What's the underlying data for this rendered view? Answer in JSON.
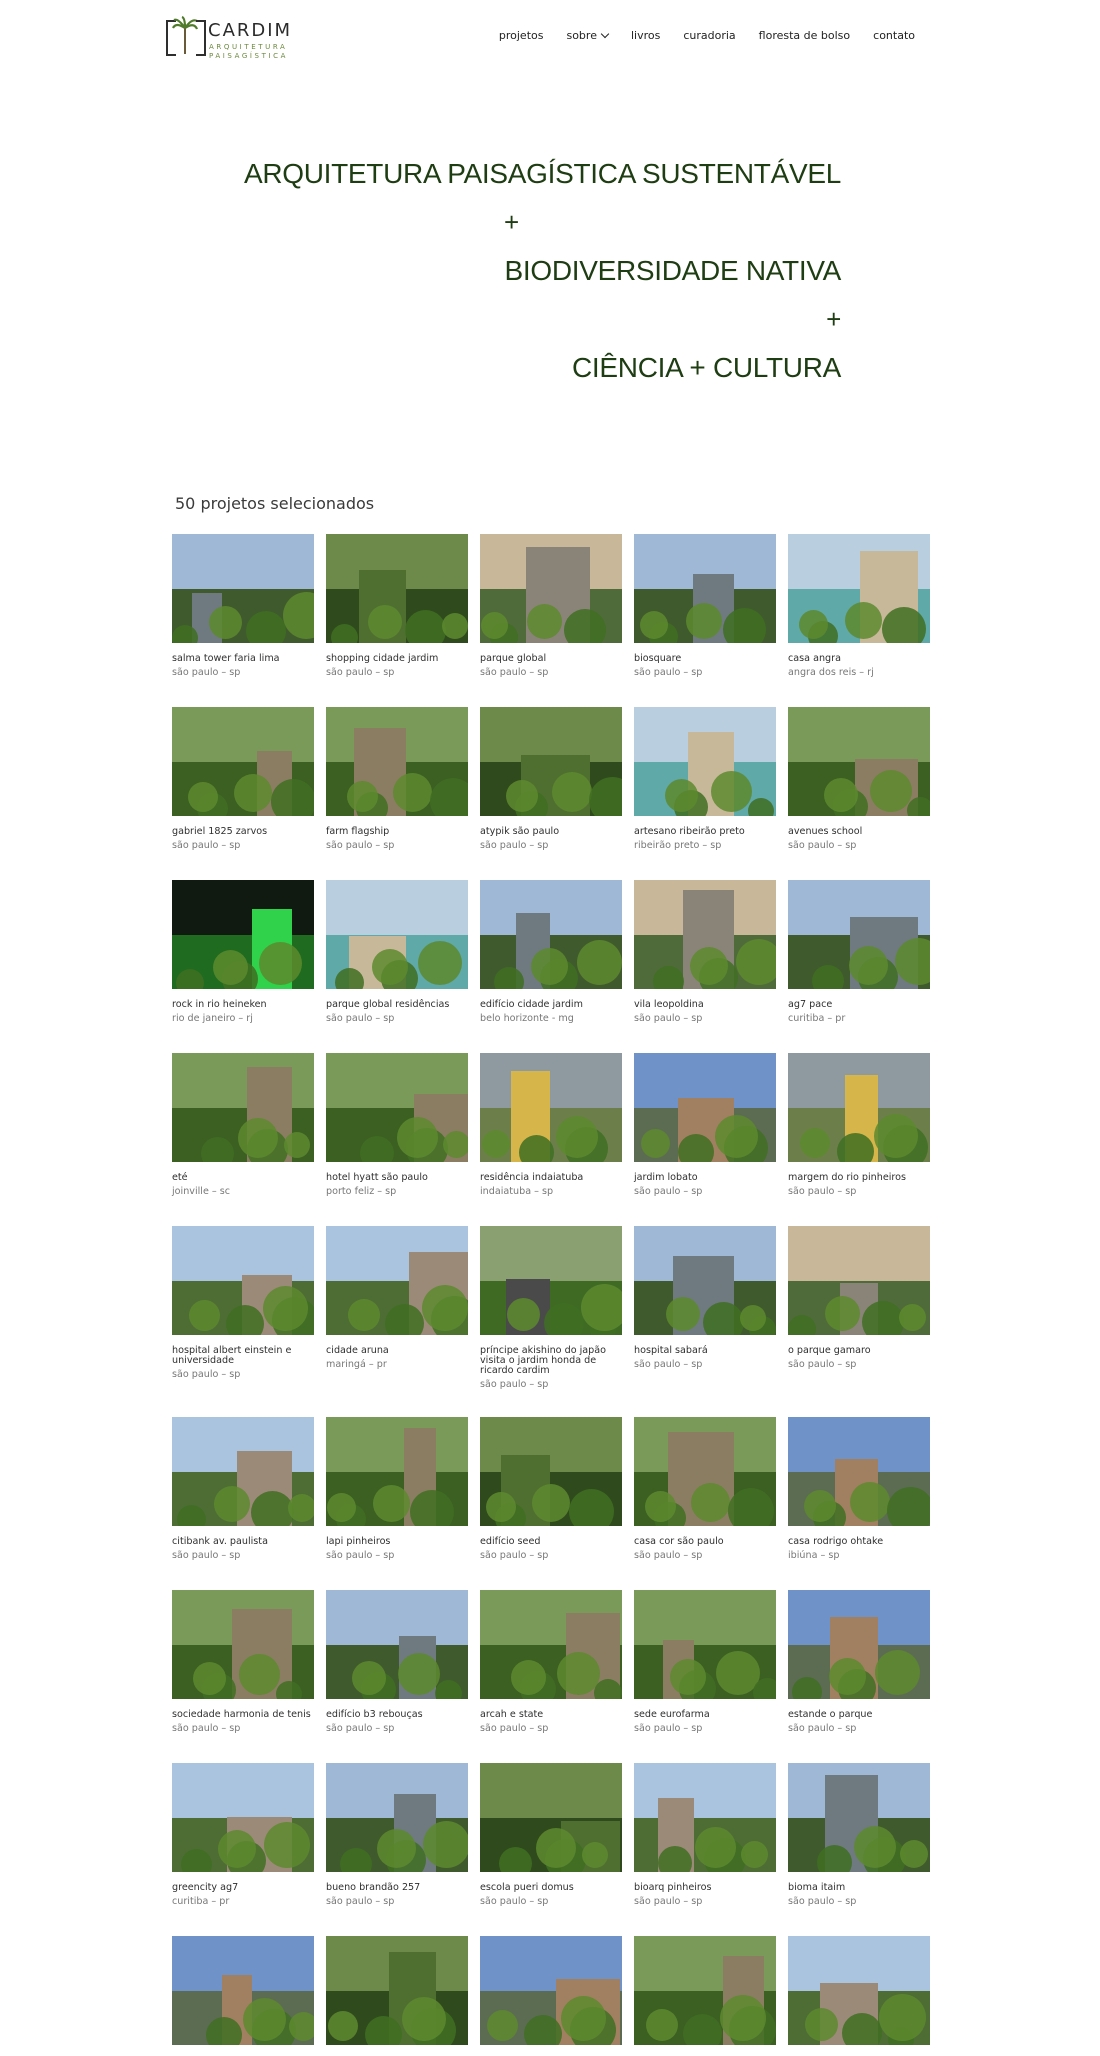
{
  "brand": {
    "name": "CARDIM",
    "tagline_1": "ARQUITETURA",
    "tagline_2": "PAISAGÍSTICA"
  },
  "nav": {
    "items": [
      {
        "label": "projetos",
        "has_dropdown": false
      },
      {
        "label": "sobre",
        "has_dropdown": true
      },
      {
        "label": "livros",
        "has_dropdown": false
      },
      {
        "label": "curadoria",
        "has_dropdown": false
      },
      {
        "label": "floresta de bolso",
        "has_dropdown": false
      },
      {
        "label": "contato",
        "has_dropdown": false
      }
    ]
  },
  "hero": {
    "line_1": "ARQUITETURA PAISAGÍSTICA SUSTENTÁVEL",
    "plus_1": "+",
    "line_2": "BIODIVERSIDADE NATIVA",
    "plus_2": "+",
    "line_3": "CIÊNCIA + CULTURA"
  },
  "projects": {
    "heading": "50 projetos selecionados",
    "items": [
      {
        "title": "salma tower faria lima",
        "location": "são paulo – sp",
        "icon": "photo-tower"
      },
      {
        "title": "shopping cidade jardim",
        "location": "são paulo – sp",
        "icon": "photo-green-wall"
      },
      {
        "title": "parque global",
        "location": "são paulo – sp",
        "icon": "photo-skyline"
      },
      {
        "title": "biosquare",
        "location": "são paulo – sp",
        "icon": "photo-tower"
      },
      {
        "title": "casa angra",
        "location": "angra dos reis – rj",
        "icon": "photo-pool"
      },
      {
        "title": "gabriel 1825 zarvos",
        "location": "são paulo – sp",
        "icon": "photo-garden"
      },
      {
        "title": "farm flagship",
        "location": "são paulo – sp",
        "icon": "photo-garden"
      },
      {
        "title": "atypik são paulo",
        "location": "são paulo – sp",
        "icon": "photo-green-wall"
      },
      {
        "title": "artesano ribeirão preto",
        "location": "ribeirão preto – sp",
        "icon": "photo-pool"
      },
      {
        "title": "avenues school",
        "location": "são paulo – sp",
        "icon": "photo-garden"
      },
      {
        "title": "rock in rio heineken",
        "location": "rio de janeiro – rj",
        "icon": "photo-neon"
      },
      {
        "title": "parque global residências",
        "location": "são paulo – sp",
        "icon": "photo-pool"
      },
      {
        "title": "edifício cidade jardim",
        "location": "belo horizonte - mg",
        "icon": "photo-tower"
      },
      {
        "title": "vila leopoldina",
        "location": "são paulo – sp",
        "icon": "photo-skyline"
      },
      {
        "title": "ag7 pace",
        "location": "curitiba – pr",
        "icon": "photo-tower"
      },
      {
        "title": "eté",
        "location": "joinville – sc",
        "icon": "photo-garden"
      },
      {
        "title": "hotel hyatt são paulo",
        "location": "porto feliz – sp",
        "icon": "photo-garden"
      },
      {
        "title": "residência indaiatuba",
        "location": "indaiatuba – sp",
        "icon": "photo-lake"
      },
      {
        "title": "jardim lobato",
        "location": "são paulo – sp",
        "icon": "photo-pavilion"
      },
      {
        "title": "margem do rio pinheiros",
        "location": "são paulo – sp",
        "icon": "photo-lake"
      },
      {
        "title": "hospital albert einstein e universidade",
        "location": "são paulo – sp",
        "icon": "photo-building"
      },
      {
        "title": "cidade aruna",
        "location": "maringá – pr",
        "icon": "photo-building"
      },
      {
        "title": "príncipe akishino do japão visita o jardim honda de ricardo cardim",
        "location": "são paulo – sp",
        "icon": "photo-people"
      },
      {
        "title": "hospital sabará",
        "location": "são paulo – sp",
        "icon": "photo-tower"
      },
      {
        "title": "o parque gamaro",
        "location": "são paulo – sp",
        "icon": "photo-skyline"
      },
      {
        "title": "citibank av. paulista",
        "location": "são paulo – sp",
        "icon": "photo-building"
      },
      {
        "title": "lapi pinheiros",
        "location": "são paulo – sp",
        "icon": "photo-garden"
      },
      {
        "title": "edifício seed",
        "location": "são paulo – sp",
        "icon": "photo-green-wall"
      },
      {
        "title": "casa cor são paulo",
        "location": "são paulo – sp",
        "icon": "photo-garden"
      },
      {
        "title": "casa rodrigo ohtake",
        "location": "ibiúna – sp",
        "icon": "photo-pavilion"
      },
      {
        "title": "sociedade harmonia de tenis",
        "location": "são paulo – sp",
        "icon": "photo-garden"
      },
      {
        "title": "edifício b3 rebouças",
        "location": "são paulo – sp",
        "icon": "photo-tower"
      },
      {
        "title": "arcah e state",
        "location": "são paulo – sp",
        "icon": "photo-garden"
      },
      {
        "title": "sede eurofarma",
        "location": "são paulo – sp",
        "icon": "photo-garden"
      },
      {
        "title": "estande o parque",
        "location": "são paulo – sp",
        "icon": "photo-pavilion"
      },
      {
        "title": "greencity ag7",
        "location": "curitiba – pr",
        "icon": "photo-building"
      },
      {
        "title": "bueno brandão 257",
        "location": "são paulo – sp",
        "icon": "photo-tower"
      },
      {
        "title": "escola pueri domus",
        "location": "são paulo – sp",
        "icon": "photo-green-wall"
      },
      {
        "title": "bioarq pinheiros",
        "location": "são paulo – sp",
        "icon": "photo-building"
      },
      {
        "title": "bioma itaim",
        "location": "são paulo – sp",
        "icon": "photo-tower"
      },
      {
        "title": "",
        "location": "",
        "icon": "photo-pavilion"
      },
      {
        "title": "",
        "location": "",
        "icon": "photo-green-wall"
      },
      {
        "title": "",
        "location": "",
        "icon": "photo-pavilion"
      },
      {
        "title": "",
        "location": "",
        "icon": "photo-garden"
      },
      {
        "title": "",
        "location": "",
        "icon": "photo-building"
      }
    ]
  },
  "colors": {
    "hero_text": "#1f3d13",
    "brand_tag": "#6b8a3c",
    "nav_text": "#222222",
    "caption_title": "#2f2f2f",
    "caption_location": "#777777"
  }
}
